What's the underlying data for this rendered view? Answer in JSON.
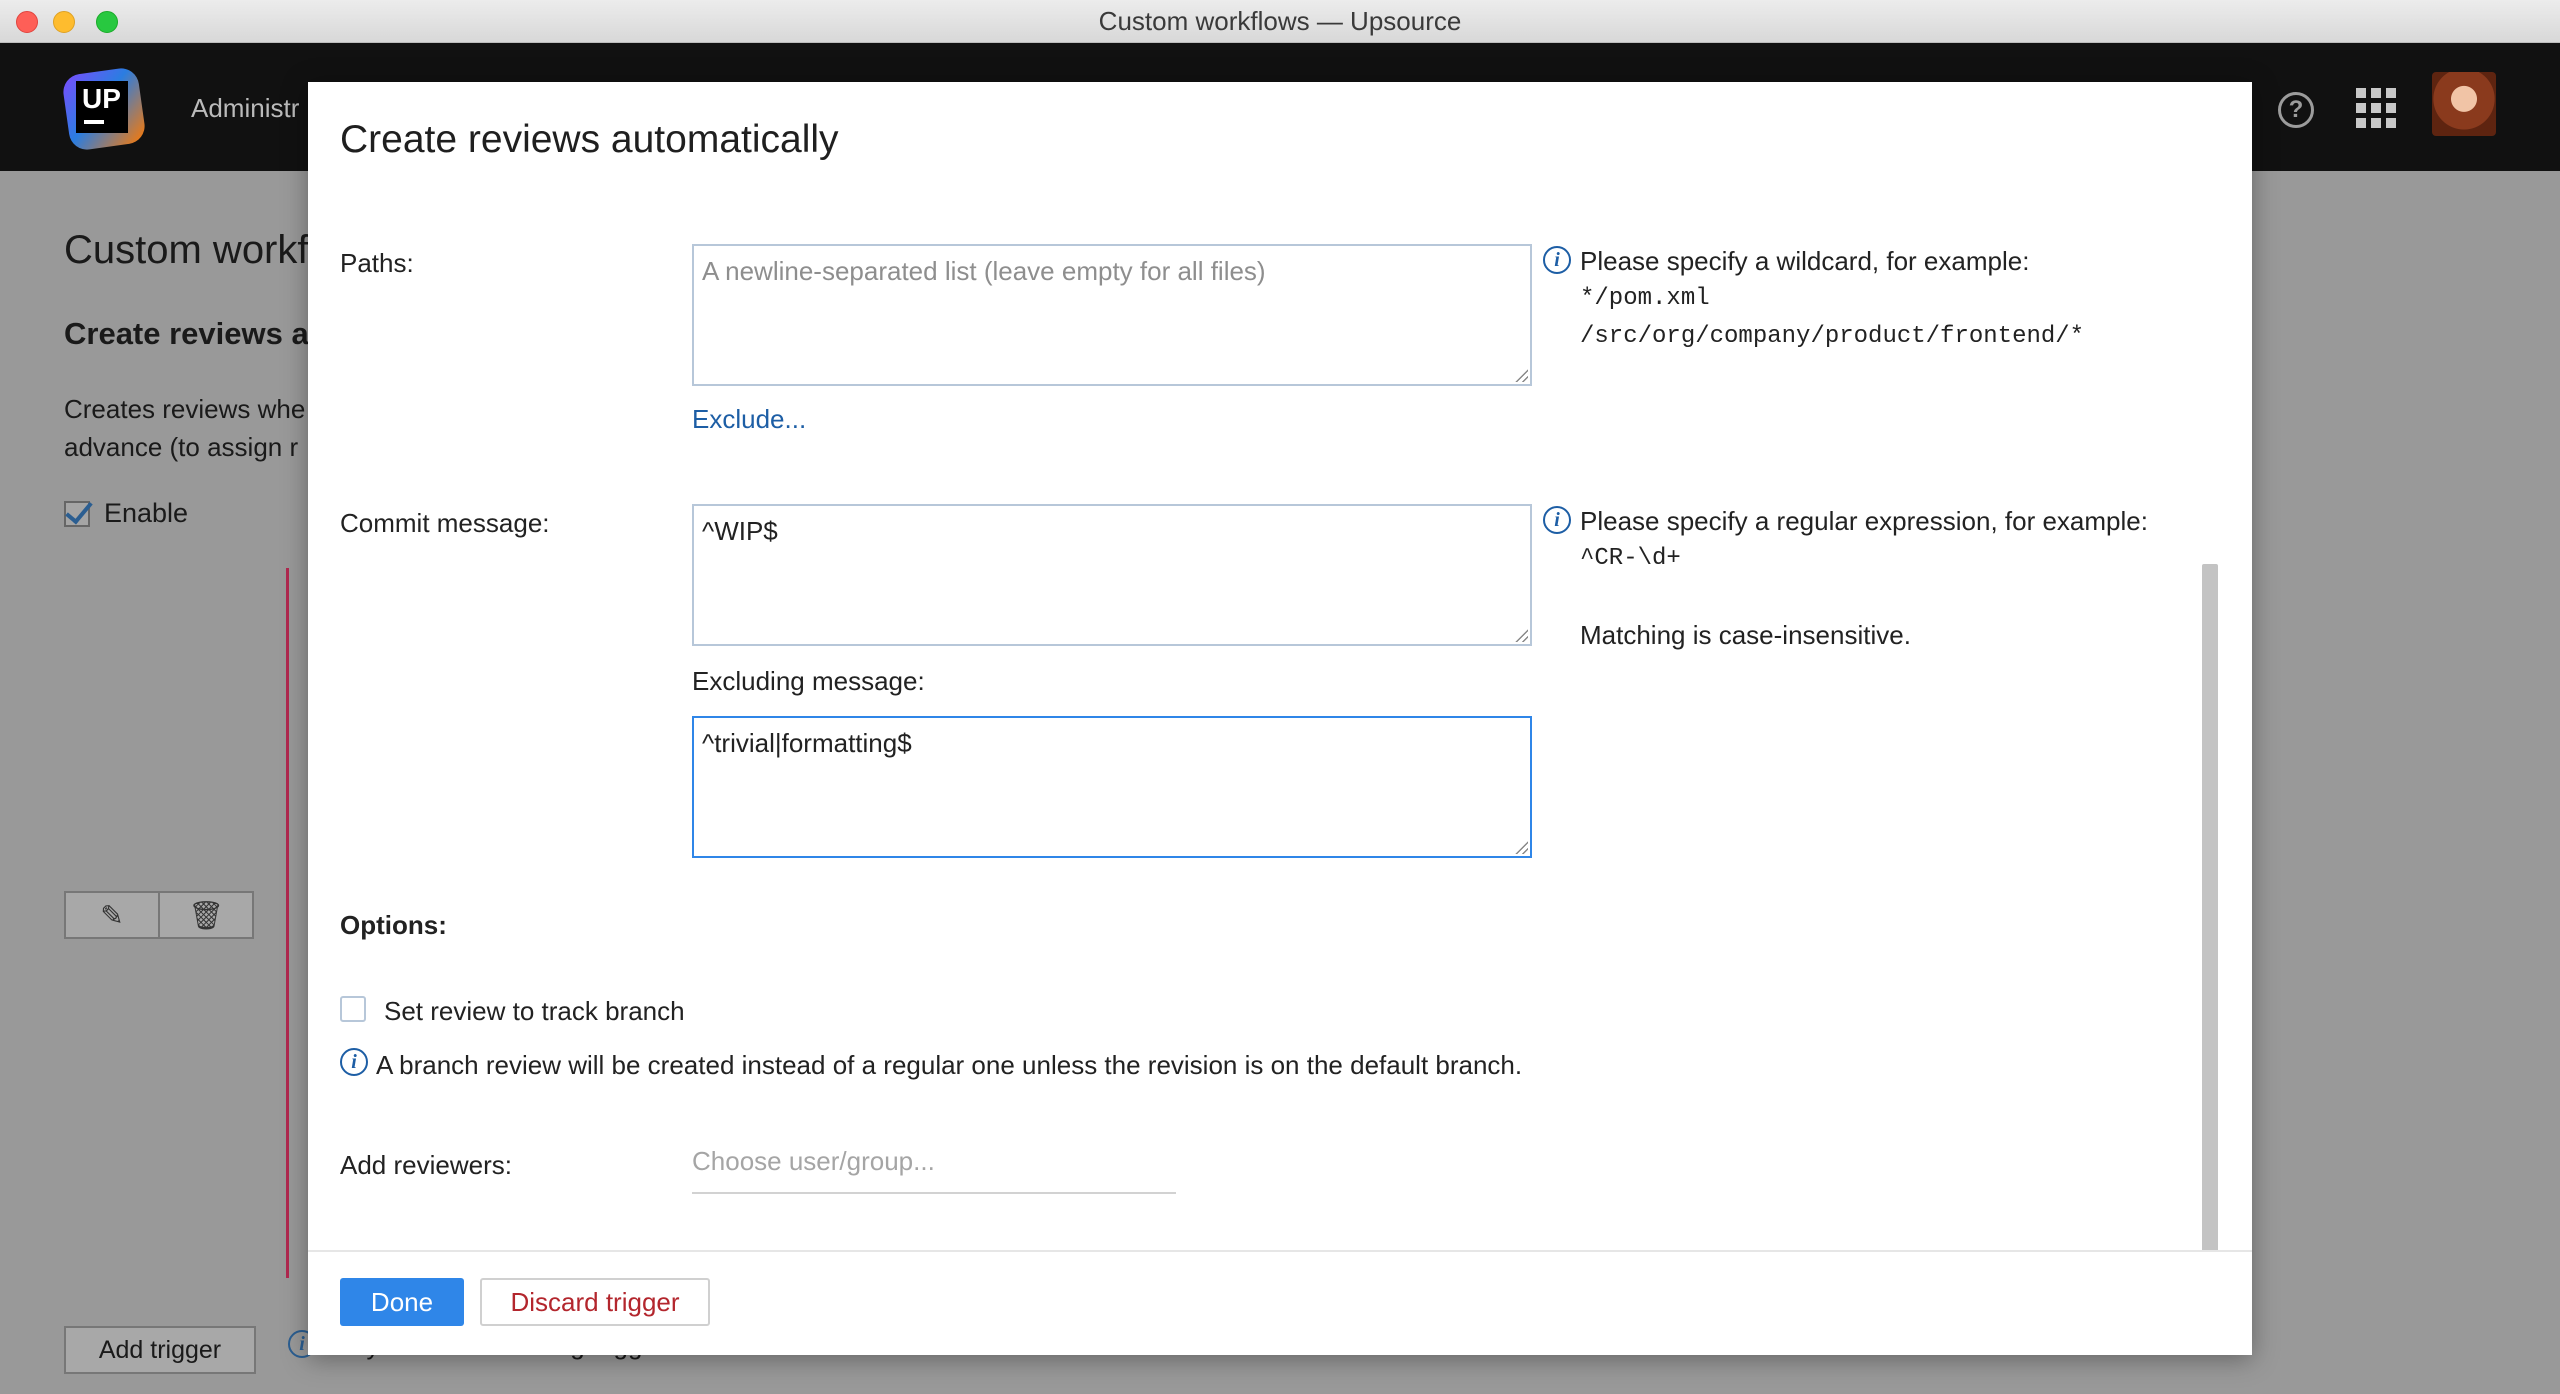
{
  "window": {
    "title": "Custom workflows — Upsource"
  },
  "header": {
    "logo_text": "UP",
    "nav_label": "Administr",
    "help_glyph": "?"
  },
  "background_page": {
    "title": "Custom workf",
    "subtitle": "Create reviews a",
    "description_line1": "Creates reviews whe",
    "description_line2": "advance (to assign r",
    "enable_label": "Enable",
    "edit_glyph": "✎",
    "delete_glyph": "🗑",
    "add_trigger_label": "Add trigger",
    "note_text": "Only the first matching trigger is executed"
  },
  "modal": {
    "title": "Create reviews automatically",
    "paths": {
      "label": "Paths:",
      "placeholder": "A newline-separated list (leave empty for all files)",
      "value": "",
      "exclude_link": "Exclude...",
      "hint_line1": "Please specify a wildcard, for example:",
      "hint_example1": "*/pom.xml",
      "hint_example2": "/src/org/company/product/frontend/*"
    },
    "commit_message": {
      "label": "Commit message:",
      "value": "^WIP$",
      "hint_line1": "Please specify a regular expression, for example:",
      "hint_example": "^CR-\\d+",
      "hint_note": "Matching is case-insensitive."
    },
    "excluding_message": {
      "label": "Excluding message:",
      "value": "^trivial|formatting$"
    },
    "options": {
      "heading": "Options:",
      "track_branch_label": "Set review to track branch",
      "track_branch_checked": false,
      "track_branch_hint": "A branch review will be created instead of a regular one unless the revision is on the default branch."
    },
    "reviewers": {
      "label": "Add reviewers:",
      "placeholder": "Choose user/group..."
    },
    "info_glyph": "i",
    "footer": {
      "done_label": "Done",
      "discard_label": "Discard trigger"
    }
  },
  "colors": {
    "accent": "#2f86e8",
    "link": "#1d5ea5",
    "danger": "#b3262d",
    "trigger_line": "#b0284f"
  }
}
